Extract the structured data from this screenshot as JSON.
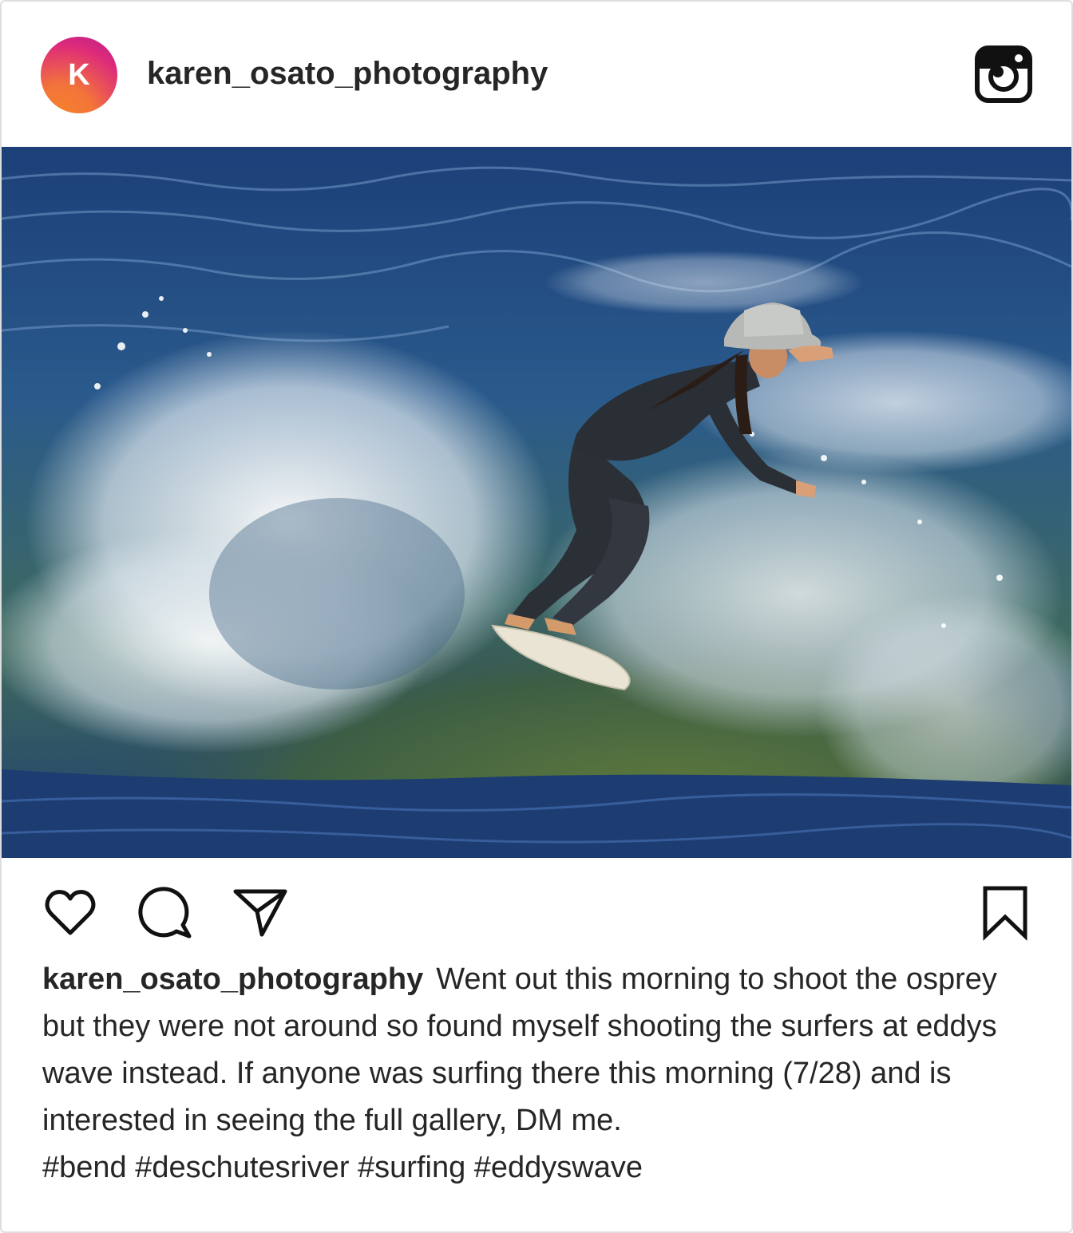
{
  "post": {
    "avatar_initial": "K",
    "username": "karen_osato_photography",
    "caption_username": "karen_osato_photography",
    "caption_text": "Went out this morning to shoot the osprey but they were not around so found myself shooting the surfers at eddys wave instead. If anyone was surfing there this morning (7/28) and is interested in seeing the full gallery, DM me.",
    "hashtags": "#bend #deschutesriver #surfing #eddyswave"
  },
  "icons": {
    "header_right": "instagram-icon",
    "like": "heart-icon",
    "comment": "comment-icon",
    "share": "send-icon",
    "save": "bookmark-icon"
  },
  "colors": {
    "text": "#262626",
    "border": "#dedede",
    "avatar_gradient_start": "#f58529",
    "avatar_gradient_end": "#b51f8f"
  }
}
